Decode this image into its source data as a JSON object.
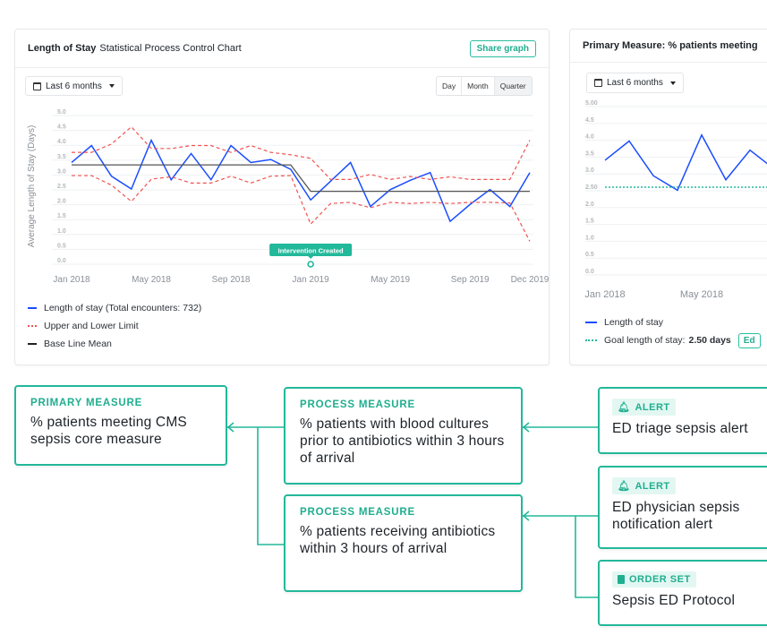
{
  "card1": {
    "title_bold": "Length of Stay",
    "title_rest": "Statistical Process Control Chart",
    "share_label": "Share graph",
    "date_range": "Last 6 months",
    "granularity": [
      "Day",
      "Month",
      "Quarter"
    ],
    "granularity_selected": "Quarter",
    "annotation": "Intervention Created",
    "legend": [
      "Length of stay (Total encounters: 732)",
      "Upper and Lower Limit",
      "Base Line Mean"
    ]
  },
  "card2": {
    "title": "Primary Measure: % patients meeting",
    "date_range": "Last 6 months",
    "legend_series": "Length of stay",
    "legend_goal_label": "Goal length of stay:",
    "legend_goal_value": "2.50 days",
    "edit_label": "Ed"
  },
  "chart_data": [
    {
      "type": "line",
      "ylabel": "Average Length of Stay (Days)",
      "ylim": [
        0,
        5
      ],
      "yticks": [
        "0.0",
        "0.5",
        "1.0",
        "1.5",
        "2.0",
        "2.5",
        "3.0",
        "3.5",
        "4.0",
        "4.5",
        "5.0"
      ],
      "xtick_labels": [
        "Jan 2018",
        "May 2018",
        "Sep 2018",
        "Jan 2019",
        "May 2019",
        "Sep 2019",
        "Dec 2019"
      ],
      "xtick_index": [
        0,
        4,
        8,
        12,
        16,
        20,
        23
      ],
      "grid": true,
      "legend_placement": "bottom",
      "colors": {
        "series": "#1a4dff",
        "limits": "#ef5350",
        "mean": "#555555",
        "annotation": "#22b89a"
      },
      "x": [
        "Jan 2018",
        "Feb 2018",
        "Mar 2018",
        "Apr 2018",
        "May 2018",
        "Jun 2018",
        "Jul 2018",
        "Aug 2018",
        "Sep 2018",
        "Oct 2018",
        "Nov 2018",
        "Dec 2018",
        "Jan 2019",
        "Feb 2019",
        "Mar 2019",
        "Apr 2019",
        "May 2019",
        "Jun 2019",
        "Jul 2019",
        "Aug 2019",
        "Sep 2019",
        "Oct 2019",
        "Nov 2019",
        "Dec 2019"
      ],
      "series": [
        {
          "name": "Length of stay (Total encounters: 732)",
          "values": [
            3.3,
            3.87,
            2.84,
            2.41,
            4.05,
            2.72,
            3.6,
            2.72,
            3.87,
            3.3,
            3.4,
            3.07,
            2.04,
            2.67,
            3.3,
            1.82,
            2.39,
            2.7,
            2.96,
            1.32,
            1.89,
            2.39,
            1.82,
            2.96
          ]
        },
        {
          "name": "Upper Limit",
          "values": [
            3.64,
            3.64,
            3.92,
            4.5,
            3.77,
            3.77,
            3.87,
            3.87,
            3.64,
            3.87,
            3.64,
            3.56,
            3.44,
            2.73,
            2.73,
            2.9,
            2.73,
            2.83,
            2.73,
            2.82,
            2.73,
            2.73,
            2.73,
            4.05
          ]
        },
        {
          "name": "Lower Limit",
          "values": [
            2.86,
            2.86,
            2.54,
            1.99,
            2.74,
            2.82,
            2.61,
            2.61,
            2.84,
            2.61,
            2.84,
            2.86,
            1.23,
            1.92,
            1.96,
            1.78,
            1.96,
            1.92,
            1.96,
            1.92,
            1.96,
            1.96,
            1.94,
            0.65
          ]
        },
        {
          "name": "Base Line Mean",
          "values": [
            3.22,
            3.22,
            3.22,
            3.22,
            3.22,
            3.22,
            3.22,
            3.22,
            3.22,
            3.22,
            3.22,
            3.22,
            2.33,
            2.33,
            2.33,
            2.33,
            2.33,
            2.33,
            2.33,
            2.33,
            2.33,
            2.33,
            2.33,
            2.33
          ]
        }
      ],
      "annotation_at": "Jan 2019"
    },
    {
      "type": "line",
      "ylim": [
        0,
        5
      ],
      "yticks": [
        "0.0",
        "0.5",
        "1.0",
        "1.5",
        "2.0",
        "2.50",
        "3.0",
        "3.5",
        "4.0",
        "4.5",
        "5.00"
      ],
      "xtick_labels": [
        "Jan 2018",
        "May 2018"
      ],
      "xtick_index": [
        0,
        4
      ],
      "grid": true,
      "legend_placement": "bottom",
      "colors": {
        "series": "#1a4dff",
        "goal": "#22b89a"
      },
      "x": [
        "Jan 2018",
        "Feb 2018",
        "Mar 2018",
        "Apr 2018",
        "May 2018",
        "Jun 2018",
        "Jul 2018",
        "Aug 2018"
      ],
      "series": [
        {
          "name": "Length of stay",
          "values": [
            3.3,
            3.87,
            2.84,
            2.41,
            4.05,
            2.72,
            3.6,
            3.04
          ]
        }
      ],
      "goal": 2.5
    }
  ],
  "flow": {
    "primary": {
      "kind": "PRIMARY MEASURE",
      "text": "% patients meeting CMS sepsis core measure"
    },
    "process1": {
      "kind": "PROCESS MEASURE",
      "text": "% patients with blood cultures prior to antibiotics within 3 hours of arrival"
    },
    "process2": {
      "kind": "PROCESS MEASURE",
      "text": "% patients receiving antibiotics within 3 hours of arrival"
    },
    "alert1": {
      "kind": "ALERT",
      "icon": "bell-icon",
      "text": "ED triage sepsis alert"
    },
    "alert2": {
      "kind": "ALERT",
      "icon": "bell-icon",
      "text": "ED physician sepsis notification alert"
    },
    "orderset": {
      "kind": "ORDER SET",
      "icon": "clipboard-icon",
      "text": "Sepsis ED Protocol"
    },
    "accent": "#22b89a"
  }
}
